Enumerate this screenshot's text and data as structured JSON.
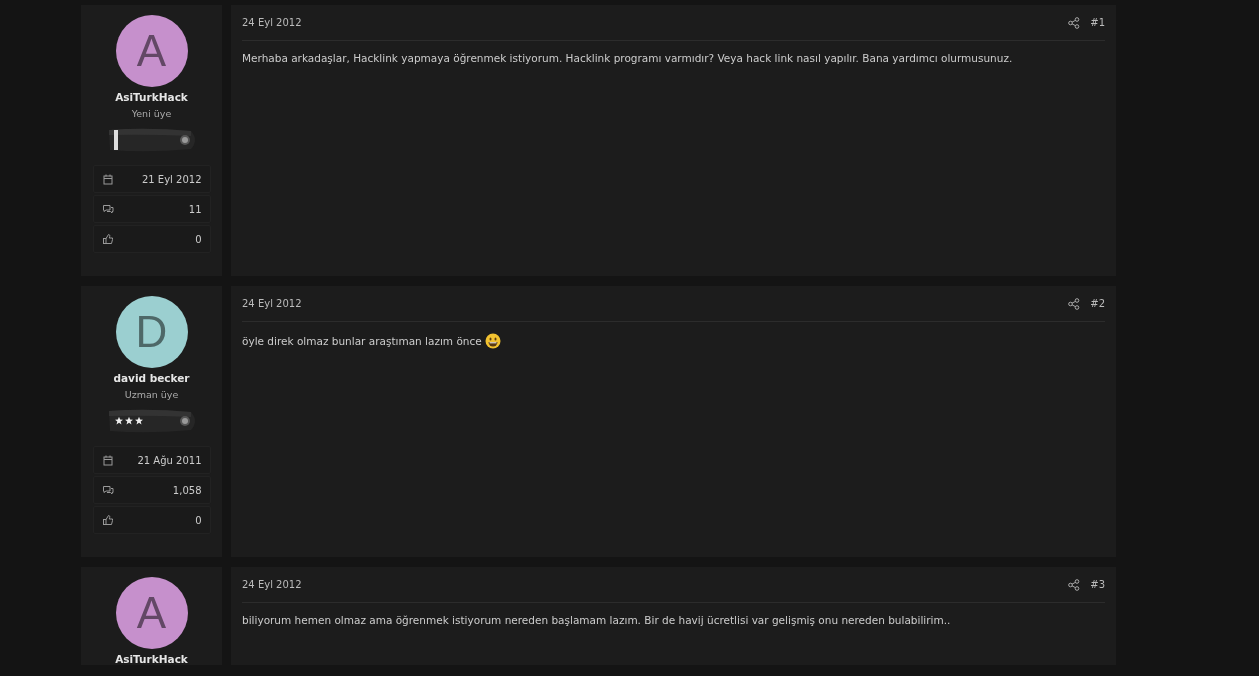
{
  "posts": [
    {
      "user": {
        "initial": "A",
        "color": "#c690cc",
        "name": "AsiTurkHack",
        "title": "Yeni üye",
        "insignia": {
          "kind": "bar"
        },
        "stats": [
          {
            "kind": "joined",
            "value": "21 Eyl 2012"
          },
          {
            "kind": "messages",
            "value": "11"
          },
          {
            "kind": "likes",
            "value": "0"
          }
        ]
      },
      "date": "24 Eyl 2012",
      "number": "#1",
      "body": "Merhaba arkadaşlar, Hacklink yapmaya öğrenmek istiyorum. Hacklink programı varmıdır? Veya hack link nasıl yapılır. Bana yardımcı olurmusunuz.",
      "emoji": false
    },
    {
      "user": {
        "initial": "D",
        "color": "#9bcfd0",
        "name": "david becker",
        "title": "Uzman üye",
        "insignia": {
          "kind": "stars"
        },
        "stats": [
          {
            "kind": "joined",
            "value": "21 Ağu 2011"
          },
          {
            "kind": "messages",
            "value": "1,058"
          },
          {
            "kind": "likes",
            "value": "0"
          }
        ]
      },
      "date": "24 Eyl 2012",
      "number": "#2",
      "body": "öyle direk olmaz bunlar araştıman lazım önce",
      "emoji": true
    },
    {
      "user": {
        "initial": "A",
        "color": "#c690cc",
        "name": "AsiTurkHack"
      },
      "date": "24 Eyl 2012",
      "number": "#3",
      "body": "biliyorum hemen olmaz ama öğrenmek istiyorum nereden başlamam lazım. Bir de havij ücretlisi var gelişmiş onu nereden bulabilirim..",
      "emoji": false
    }
  ]
}
